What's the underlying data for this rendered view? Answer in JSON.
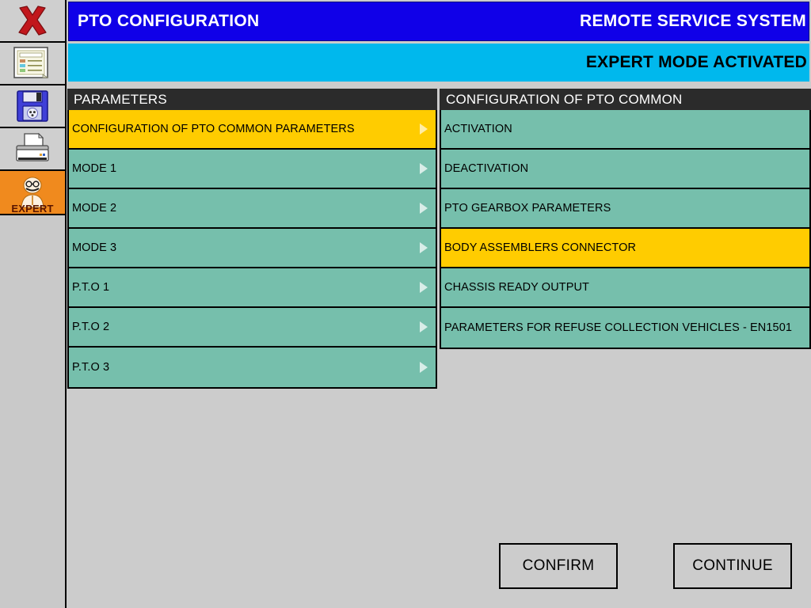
{
  "header": {
    "title": "PTO CONFIGURATION",
    "system_name": "REMOTE SERVICE SYSTEM",
    "status": "EXPERT MODE ACTIVATED",
    "title_bg": "#1000E8",
    "status_bg": "#00B8ED"
  },
  "sidebar": {
    "items": [
      {
        "name": "close",
        "icon": "close-x-icon",
        "label": ""
      },
      {
        "name": "report",
        "icon": "document-report-icon",
        "label": ""
      },
      {
        "name": "save",
        "icon": "floppy-disk-save-icon",
        "label": ""
      },
      {
        "name": "print",
        "icon": "printer-icon",
        "label": ""
      },
      {
        "name": "expert",
        "icon": "expert-person-icon",
        "label": "EXPERT"
      }
    ],
    "expert_label": "EXPERT",
    "expert_bg": "#F08A1E"
  },
  "panels": {
    "left": {
      "header": "PARAMETERS",
      "rows": [
        {
          "label": "CONFIGURATION OF PTO COMMON PARAMETERS",
          "selected": true
        },
        {
          "label": "MODE 1",
          "selected": false
        },
        {
          "label": "MODE 2",
          "selected": false
        },
        {
          "label": "MODE 3",
          "selected": false
        },
        {
          "label": "P.T.O 1",
          "selected": false
        },
        {
          "label": "P.T.O 2",
          "selected": false
        },
        {
          "label": "P.T.O 3",
          "selected": false
        }
      ]
    },
    "right": {
      "header": "CONFIGURATION OF PTO COMMON",
      "rows": [
        {
          "label": "ACTIVATION",
          "selected": false
        },
        {
          "label": "DEACTIVATION",
          "selected": false
        },
        {
          "label": "PTO GEARBOX PARAMETERS",
          "selected": false
        },
        {
          "label": "BODY ASSEMBLERS CONNECTOR",
          "selected": true
        },
        {
          "label": "CHASSIS READY OUTPUT",
          "selected": false
        },
        {
          "label": "PARAMETERS FOR REFUSE COLLECTION VEHICLES - EN1501",
          "selected": false
        }
      ]
    },
    "row_color": "#76BFAC",
    "selected_color": "#FFCC00",
    "header_color": "#2B2B2B"
  },
  "buttons": {
    "confirm": "CONFIRM",
    "continue": "CONTINUE"
  }
}
